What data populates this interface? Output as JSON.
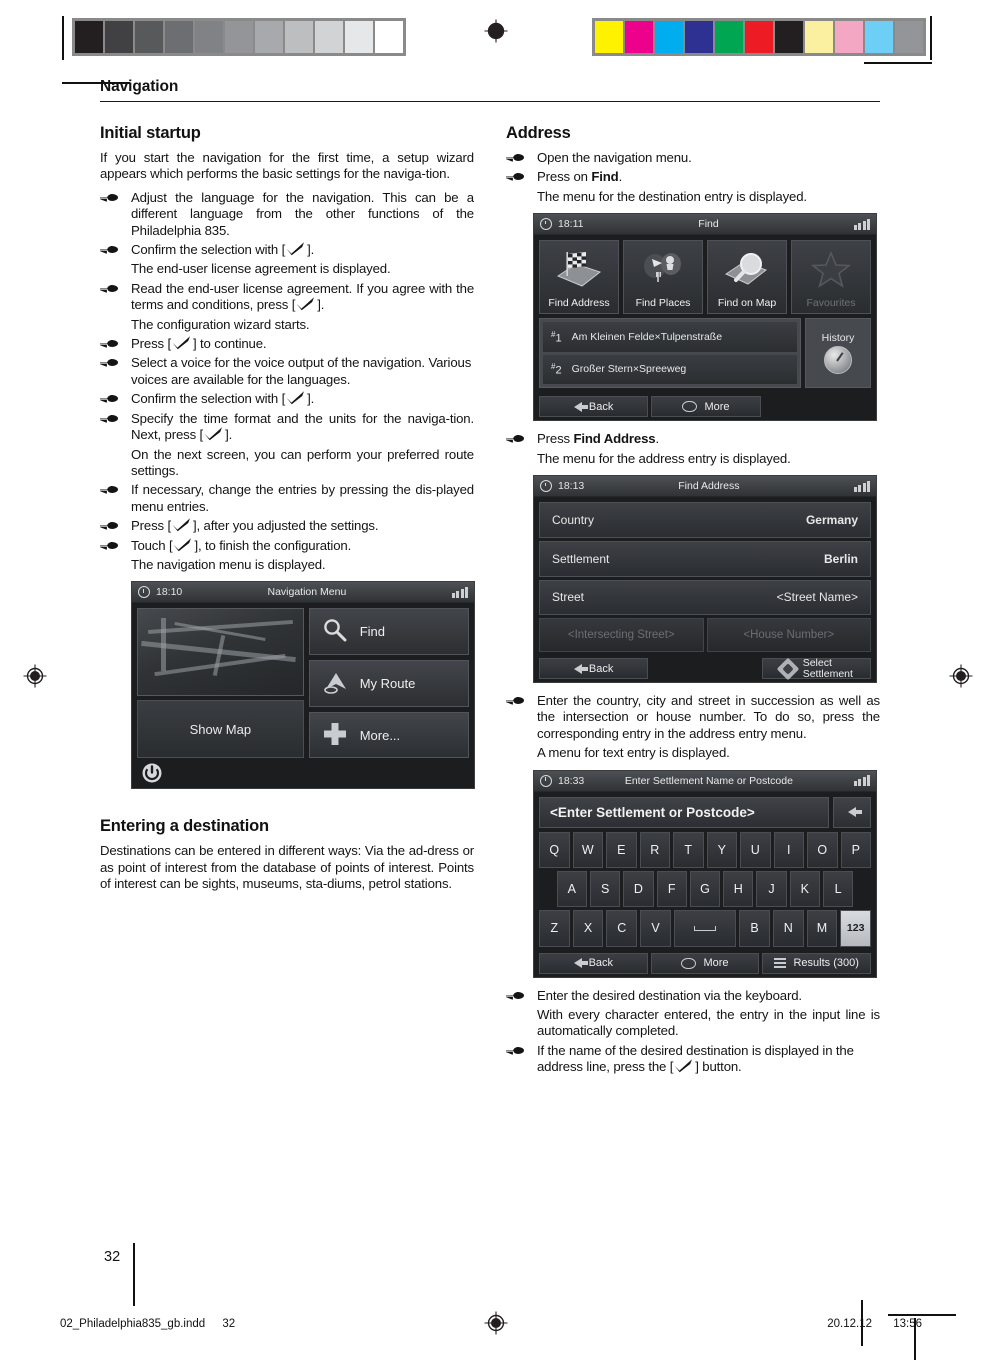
{
  "prepress": {
    "gray_swatches": [
      "#231f20",
      "#414042",
      "#58595b",
      "#6d6e71",
      "#808285",
      "#939598",
      "#a7a9ac",
      "#bcbec0",
      "#d1d3d4",
      "#e6e7e8",
      "#ffffff"
    ],
    "color_swatches": [
      "#fff200",
      "#ec008c",
      "#00aeef",
      "#2e3192",
      "#00a651",
      "#ed1c24",
      "#231f20",
      "#fbf0a0",
      "#f4a7c3",
      "#6dcff6",
      "#939598"
    ],
    "registration_mark": "registration-target-icon"
  },
  "header": {
    "running_head": "Navigation"
  },
  "left_column": {
    "section_title": "Initial startup",
    "intro": "If you start the navigation for the first time, a setup wizard appears which performs the basic settings for the naviga-tion.",
    "steps": [
      {
        "type": "step",
        "text_before": "Adjust the language for the navigation. This can be a different language from the other functions of the Philadelphia 835.",
        "justify": true
      },
      {
        "type": "step",
        "text_before": "Confirm the selection with [",
        "check": true,
        "text_after": "]."
      },
      {
        "type": "sub",
        "text_before": "The end-user license agreement is displayed."
      },
      {
        "type": "step",
        "text_before": "Read the end-user license agreement. If you agree with the terms and conditions, press [",
        "check": true,
        "text_after": "].",
        "justify": true
      },
      {
        "type": "sub",
        "text_before": "The configuration wizard starts."
      },
      {
        "type": "step",
        "text_before": "Press [",
        "check": true,
        "text_after": "] to continue."
      },
      {
        "type": "step",
        "text_before": "Select a voice for the voice output of the navigation. Various voices are available for the languages."
      },
      {
        "type": "step",
        "text_before": "Confirm the selection with [",
        "check": true,
        "text_after": "]."
      },
      {
        "type": "step",
        "text_before": "Specify the time format and the units for the naviga-tion. Next, press [",
        "check": true,
        "text_after": "]."
      },
      {
        "type": "sub",
        "text_before": "On the next screen, you can perform your preferred route settings."
      },
      {
        "type": "step",
        "text_before": "If necessary, change the entries by pressing the dis-played menu entries."
      },
      {
        "type": "step",
        "text_before": "Press [",
        "check": true,
        "text_after": "], after you adjusted the settings."
      },
      {
        "type": "step",
        "text_before": "Touch [",
        "check": true,
        "text_after": "], to finish the configuration."
      },
      {
        "type": "sub",
        "text_before": "The navigation menu is displayed."
      }
    ],
    "section_title_2": "Entering a destination",
    "dest_paragraph": "Destinations can be entered in different ways: Via the ad-dress or as point of interest from the database of points of interest. Points of interest can be sights, museums, sta-diums, petrol stations."
  },
  "right_column": {
    "section_title": "Address",
    "steps": [
      {
        "type": "step",
        "text_before": "Open the navigation menu."
      },
      {
        "type": "step",
        "text_before": "Press on ",
        "bold": "Find",
        "text_after": "."
      },
      {
        "type": "sub",
        "text_before": "The menu for the destination entry is displayed."
      }
    ],
    "step_find_address": {
      "text_before": "Press ",
      "bold": "Find Address",
      "text_after": "."
    },
    "sub_address_entry": "The menu for the address entry is displayed.",
    "step_enter_country": "Enter the country, city and street in succession as well as the intersection or house number. To do so, press the corresponding entry in the address entry menu.",
    "sub_text_entry": "A menu for text entry is displayed.",
    "step_enter_destination": "Enter the desired destination via the keyboard.",
    "sub_autocomplete": "With every character entered, the entry in the input line is automatically completed.",
    "step_press_button_before": "If the name of the desired destination is displayed in the address line, press the [",
    "step_press_button_after": "] button."
  },
  "screens": {
    "navigation_menu": {
      "time": "18:10",
      "title": "Navigation Menu",
      "show_map": "Show Map",
      "buttons": [
        {
          "label": "Find",
          "icon": "magnifier-icon"
        },
        {
          "label": "My Route",
          "icon": "route-arrow-icon"
        },
        {
          "label": "More...",
          "icon": "plus-icon"
        }
      ],
      "power_icon": "power-icon",
      "signal_icon": "signal-bars-icon"
    },
    "find": {
      "time": "18:11",
      "title": "Find",
      "tiles": [
        {
          "label": "Find Address",
          "icon": "checkered-flag-map-icon",
          "disabled": false
        },
        {
          "label": "Find Places",
          "icon": "poi-pins-icon",
          "disabled": false
        },
        {
          "label": "Find on Map",
          "icon": "map-magnifier-icon",
          "disabled": false
        },
        {
          "label": "Favourites",
          "icon": "star-icon",
          "disabled": true
        }
      ],
      "history_items": [
        {
          "rank": "1",
          "label": "Am Kleinen Felde×Tulpenstraße"
        },
        {
          "rank": "2",
          "label": "Großer Stern×Spreeweg"
        }
      ],
      "history_button": "History",
      "bottom": [
        {
          "label": "Back",
          "icon": "arrow-left-icon"
        },
        {
          "label": "More",
          "icon": "oval-icon"
        }
      ]
    },
    "find_address": {
      "time": "18:13",
      "title": "Find Address",
      "rows": [
        {
          "label": "Country",
          "value": "Germany",
          "bold": true
        },
        {
          "label": "Settlement",
          "value": "Berlin",
          "bold": true
        },
        {
          "label": "Street",
          "value": "<Street Name>",
          "bold": false
        }
      ],
      "pair": [
        "<Intersecting Street>",
        "<House Number>"
      ],
      "bottom": [
        {
          "label": "Back",
          "icon": "arrow-left-icon"
        },
        {
          "label": "Select Settlement",
          "label_line1": "Select",
          "label_line2": "Settlement",
          "icon": "diamond-select-icon"
        }
      ]
    },
    "keyboard": {
      "time": "18:33",
      "title": "Enter Settlement Name or Postcode",
      "input_value": "<Enter Settlement or Postcode>",
      "backspace_icon": "arrow-left-icon",
      "rows": [
        [
          "Q",
          "W",
          "E",
          "R",
          "T",
          "Y",
          "U",
          "I",
          "O",
          "P"
        ],
        [
          "A",
          "S",
          "D",
          "F",
          "G",
          "H",
          "J",
          "K",
          "L"
        ],
        [
          "Z",
          "X",
          "C",
          "V",
          "␣",
          "B",
          "N",
          "M",
          "123"
        ]
      ],
      "bottom": [
        {
          "label": "Back",
          "icon": "arrow-left-icon"
        },
        {
          "label": "More",
          "icon": "oval-icon"
        },
        {
          "label": "Results (300)",
          "icon": "list-icon"
        }
      ]
    }
  },
  "footer": {
    "page_number": "32",
    "file_name": "02_Philadelphia835_gb.indd",
    "file_page": "32",
    "date": "20.12.12",
    "time": "13:56"
  }
}
